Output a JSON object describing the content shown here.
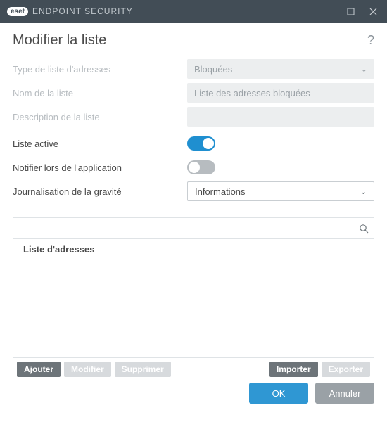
{
  "window": {
    "brand_boxed": "eset",
    "brand_text": "ENDPOINT SECURITY"
  },
  "page": {
    "title": "Modifier la liste",
    "help_glyph": "?"
  },
  "fields": {
    "type_label": "Type de liste d'adresses",
    "type_value": "Bloquées",
    "name_label": "Nom de la liste",
    "name_value": "Liste des adresses bloquées",
    "desc_label": "Description de la liste",
    "desc_value": "",
    "active_label": "Liste active",
    "active_on": true,
    "notify_label": "Notifier lors de l'application",
    "notify_on": false,
    "severity_label": "Journalisation de la gravité",
    "severity_value": "Informations"
  },
  "list": {
    "header": "Liste d'adresses",
    "search_placeholder": "",
    "actions": {
      "add": "Ajouter",
      "edit": "Modifier",
      "delete": "Supprimer",
      "import": "Importer",
      "export": "Exporter"
    }
  },
  "footer": {
    "ok": "OK",
    "cancel": "Annuler"
  }
}
